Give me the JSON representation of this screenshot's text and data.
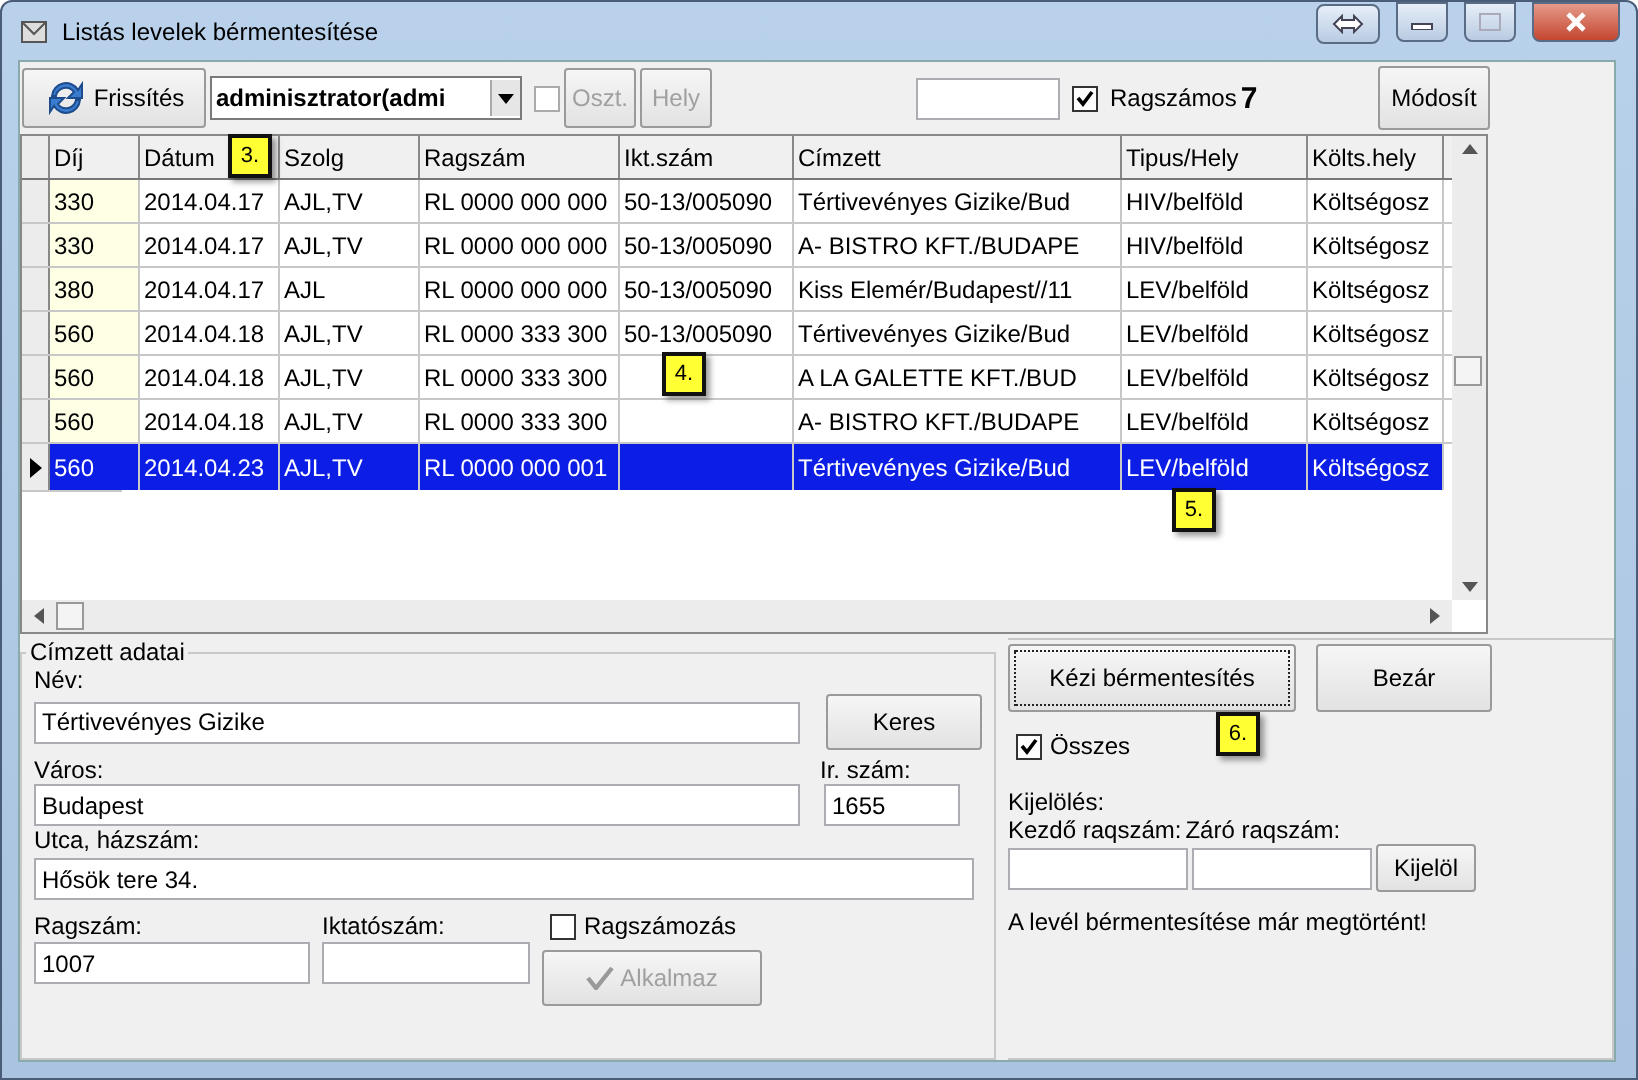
{
  "window": {
    "title": "Listás levelek bérmentesítése"
  },
  "toolbar": {
    "refresh_button": "Frissítés",
    "user_dropdown": "adminisztrator(admi",
    "dept_checkbox": {
      "checked": false,
      "disabled": true
    },
    "dept_button": {
      "label": "Oszt.",
      "disabled": true
    },
    "place_button": {
      "label": "Hely",
      "disabled": true
    },
    "ragszamos_checkbox": {
      "label": "Ragszámos",
      "checked": true
    },
    "count": "7",
    "modify_button": "Módosít"
  },
  "table": {
    "columns": [
      "Díj",
      "Dátum",
      "Szolg",
      "Ragszám",
      "Ikt.szám",
      "Címzett",
      "Tipus/Hely",
      "Költs.hely"
    ],
    "rows": [
      {
        "selected": false,
        "cells": [
          "330",
          "2014.04.17",
          "AJL,TV",
          "RL 0000 000 000",
          "50-13/005090",
          "Tértivevényes Gizike/Bud",
          "HIV/belföld",
          "Költségosz"
        ]
      },
      {
        "selected": false,
        "cells": [
          "330",
          "2014.04.17",
          "AJL,TV",
          "RL 0000 000 000",
          "50-13/005090",
          "A- BISTRO KFT./BUDAPE",
          "HIV/belföld",
          "Költségosz"
        ]
      },
      {
        "selected": false,
        "cells": [
          "380",
          "2014.04.17",
          "AJL",
          "RL 0000 000 000",
          "50-13/005090",
          "Kiss Elemér/Budapest//11",
          "LEV/belföld",
          "Költségosz"
        ]
      },
      {
        "selected": false,
        "cells": [
          "560",
          "2014.04.18",
          "AJL,TV",
          "RL 0000 333 300",
          "50-13/005090",
          "Tértivevényes Gizike/Bud",
          "LEV/belföld",
          "Költségosz"
        ]
      },
      {
        "selected": false,
        "cells": [
          "560",
          "2014.04.18",
          "AJL,TV",
          "RL 0000 333 300",
          null,
          "A LA GALETTE KFT./BUD",
          "LEV/belföld",
          "Költségosz"
        ]
      },
      {
        "selected": false,
        "cells": [
          "560",
          "2014.04.18",
          "AJL,TV",
          "RL 0000 333 300",
          null,
          "A- BISTRO KFT./BUDAPE",
          "LEV/belföld",
          "Költségosz"
        ]
      },
      {
        "selected": true,
        "cells": [
          "560",
          "2014.04.23",
          "AJL,TV",
          "RL 0000 000 001",
          null,
          "Tértivevényes Gizike/Bud",
          "LEV/belföld",
          "Költségosz"
        ]
      }
    ]
  },
  "recipient": {
    "group_title": "Címzett adatai",
    "name": {
      "label": "Név:",
      "value": "Tértivevényes Gizike"
    },
    "search_button": "Keres",
    "city": {
      "label": "Város:",
      "value": "Budapest"
    },
    "zip": {
      "label": "Ir. szám:",
      "value": "1655"
    },
    "street": {
      "label": "Utca, házszám:",
      "value": "Hősök tere 34."
    },
    "ragszam": {
      "label": "Ragszám:",
      "value": "1007"
    },
    "iktatoszam": {
      "label": "Iktatószám:"
    },
    "ragszamozas_checkbox": {
      "label": "Ragszámozás",
      "checked": false
    },
    "apply_button": {
      "label": "Alkalmaz",
      "disabled": true
    }
  },
  "actions": {
    "manual_button": "Kézi bérmentesítés",
    "close_button": "Bezár",
    "all_checkbox": {
      "label": "Összes",
      "checked": true
    },
    "selection_label": "Kijelölés:",
    "start_label": "Kezdő raqszám:",
    "end_label": "Záró raqszám:",
    "select_button": "Kijelöl",
    "message": "A levél bérmentesítése már megtörtént!"
  },
  "callouts": [
    "3.",
    "4.",
    "5.",
    "6."
  ]
}
